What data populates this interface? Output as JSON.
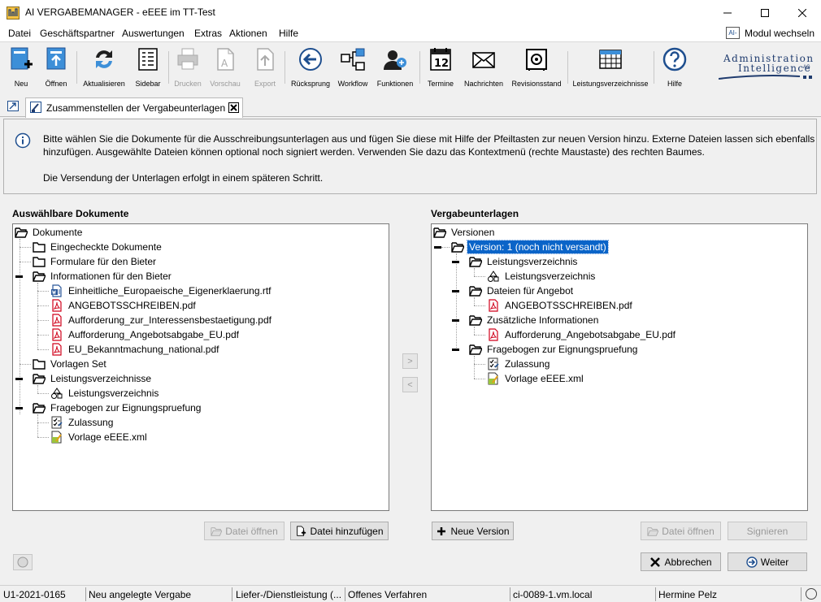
{
  "window": {
    "title": "AI VERGABEMANAGER - eEEE im TT-Test"
  },
  "menu": {
    "items": [
      "Datei",
      "Geschäftspartner",
      "Auswertungen",
      "Extras",
      "Aktionen",
      "Hilfe"
    ],
    "modul_wechseln": "Modul wechseln",
    "modul_icon_text": "AI-"
  },
  "toolbar": {
    "buttons": [
      {
        "label": "Neu",
        "icon": "new-icon",
        "enabled": true
      },
      {
        "label": "Öffnen",
        "icon": "open-icon",
        "enabled": true
      },
      {
        "label": "Aktualisieren",
        "icon": "refresh-icon",
        "enabled": true
      },
      {
        "label": "Sidebar",
        "icon": "sidebar-icon",
        "enabled": true
      },
      {
        "label": "Drucken",
        "icon": "print-icon",
        "enabled": false
      },
      {
        "label": "Vorschau",
        "icon": "preview-icon",
        "enabled": false
      },
      {
        "label": "Export",
        "icon": "export-icon",
        "enabled": false
      },
      {
        "label": "Rücksprung",
        "icon": "back-icon",
        "enabled": true
      },
      {
        "label": "Workflow",
        "icon": "workflow-icon",
        "enabled": true
      },
      {
        "label": "Funktionen",
        "icon": "functions-icon",
        "enabled": true
      },
      {
        "label": "Termine",
        "icon": "calendar-icon",
        "enabled": true
      },
      {
        "label": "Nachrichten",
        "icon": "mail-icon",
        "enabled": true
      },
      {
        "label": "Revisionsstand",
        "icon": "safe-icon",
        "enabled": true
      },
      {
        "label": "Leistungsverzeichnisse",
        "icon": "table-icon",
        "enabled": true
      },
      {
        "label": "Hilfe",
        "icon": "help-icon",
        "enabled": true
      }
    ],
    "calendar_day": "12",
    "brand_line1": "Administration",
    "brand_line2": "Intelligence",
    "brand_suffix": "AG"
  },
  "tab": {
    "label": "Zusammenstellen der Vergabeunterlagen"
  },
  "info": {
    "line1": "Bitte wählen Sie die Dokumente für die Ausschreibungsunterlagen aus und fügen Sie diese mit Hilfe der Pfeiltasten zur neuen Version hinzu. Externe Dateien lassen sich ebenfalls",
    "line2": "hinzufügen. Ausgewählte Dateien können optional noch signiert werden. Verwenden Sie dazu das Kontextmenü (rechte Maustaste) des rechten Baumes.",
    "line3": "Die Versendung der Unterlagen erfolgt in einem späteren Schritt."
  },
  "left": {
    "title": "Auswählbare Dokumente",
    "tree": [
      {
        "label": "Dokumente",
        "icon": "folder-open-icon",
        "level": 0
      },
      {
        "label": "Eingecheckte Dokumente",
        "icon": "folder-icon",
        "level": 1
      },
      {
        "label": "Formulare für den Bieter",
        "icon": "folder-icon",
        "level": 1
      },
      {
        "label": "Informationen für den Bieter",
        "icon": "folder-open-icon",
        "level": 1
      },
      {
        "label": "Einheitliche_Europaeische_Eigenerklaerung.rtf",
        "icon": "rtf-file-icon",
        "level": 2
      },
      {
        "label": "ANGEBOTSSCHREIBEN.pdf",
        "icon": "pdf-file-icon",
        "level": 2
      },
      {
        "label": "Aufforderung_zur_Interessensbestaetigung.pdf",
        "icon": "pdf-file-icon",
        "level": 2
      },
      {
        "label": "Aufforderung_Angebotsabgabe_EU.pdf",
        "icon": "pdf-file-icon",
        "level": 2
      },
      {
        "label": "EU_Bekanntmachung_national.pdf",
        "icon": "pdf-file-icon",
        "level": 2
      },
      {
        "label": "Vorlagen Set",
        "icon": "folder-icon",
        "level": 1
      },
      {
        "label": "Leistungsverzeichnisse",
        "icon": "folder-open-icon",
        "level": 1
      },
      {
        "label": "Leistungsverzeichnis",
        "icon": "shapes-icon",
        "level": 2
      },
      {
        "label": "Fragebogen zur Eignungspruefung",
        "icon": "folder-open-icon",
        "level": 1
      },
      {
        "label": "Zulassung",
        "icon": "checklist-icon",
        "level": 2
      },
      {
        "label": "Vorlage eEEE.xml",
        "icon": "xml-file-icon",
        "level": 2
      }
    ],
    "btn_open": "Datei öffnen",
    "btn_add": "Datei hinzufügen"
  },
  "right": {
    "title": "Vergabeunterlagen",
    "tree": [
      {
        "label": "Versionen",
        "icon": "folder-open-icon",
        "level": 0
      },
      {
        "label": "Version: 1 (noch nicht versandt)",
        "icon": "folder-open-icon",
        "level": 1,
        "selected": true
      },
      {
        "label": "Leistungsverzeichnis",
        "icon": "folder-open-icon",
        "level": 2
      },
      {
        "label": "Leistungsverzeichnis",
        "icon": "shapes-icon",
        "level": 3
      },
      {
        "label": "Dateien für Angebot",
        "icon": "folder-open-icon",
        "level": 2
      },
      {
        "label": "ANGEBOTSSCHREIBEN.pdf",
        "icon": "pdf-file-icon",
        "level": 3
      },
      {
        "label": "Zusätzliche Informationen",
        "icon": "folder-open-icon",
        "level": 2
      },
      {
        "label": "Aufforderung_Angebotsabgabe_EU.pdf",
        "icon": "pdf-file-icon",
        "level": 3
      },
      {
        "label": "Fragebogen zur Eignungspruefung",
        "icon": "folder-open-icon",
        "level": 2
      },
      {
        "label": "Zulassung",
        "icon": "checklist-icon",
        "level": 3
      },
      {
        "label": "Vorlage eEEE.xml",
        "icon": "xml-file-icon",
        "level": 3
      }
    ],
    "btn_new_version": "Neue Version",
    "btn_open": "Datei öffnen",
    "btn_sign": "Signieren"
  },
  "transfer": {
    "right": ">",
    "left": "<"
  },
  "footer": {
    "btn_cancel": "Abbrechen",
    "btn_next": "Weiter"
  },
  "status": {
    "cells": [
      "U1-2021-0165",
      "Neu angelegte Vergabe",
      "Liefer-/Dienstleistung (...",
      "Offenes Verfahren",
      "ci-0089-1.vm.local",
      "Hermine Pelz"
    ]
  },
  "colors": {
    "selection": "#0a64c8",
    "brand": "#1f3b6e",
    "folder": "#000000",
    "pdf": "#d0021b"
  }
}
